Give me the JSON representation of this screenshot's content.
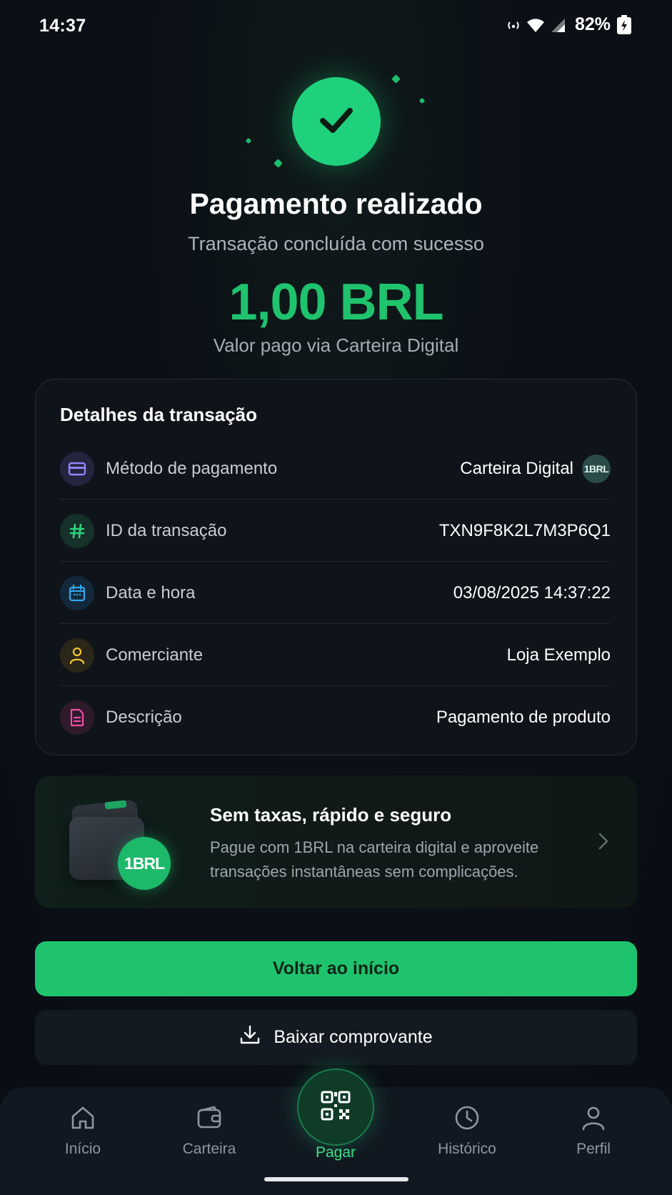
{
  "status_bar": {
    "time": "14:37",
    "battery": "82%",
    "icons": [
      "hotspot-icon",
      "wifi-icon",
      "signal-icon",
      "battery-icon"
    ]
  },
  "hero": {
    "title": "Pagamento realizado",
    "subtitle": "Transação concluída com sucesso",
    "amount": "1,00 BRL",
    "amount_caption": "Valor pago via Carteira Digital",
    "icon": "check-icon"
  },
  "details": {
    "title": "Detalhes da transação",
    "rows": [
      {
        "label": "Método de pagamento",
        "value": "Carteira Digital",
        "icon": "card-icon",
        "badge": "1BRL"
      },
      {
        "label": "ID da transação",
        "value": "TXN9F8K2L7M3P6Q1",
        "icon": "hash-icon"
      },
      {
        "label": "Data e hora",
        "value": "03/08/2025 14:37:22",
        "icon": "calendar-icon"
      },
      {
        "label": "Comerciante",
        "value": "Loja Exemplo",
        "icon": "user-icon"
      },
      {
        "label": "Descrição",
        "value": "Pagamento de produto",
        "icon": "document-icon"
      }
    ]
  },
  "promo": {
    "title": "Sem taxas, rápido e seguro",
    "text": "Pague com 1BRL na carteira digital e aproveite transações instantâneas sem complicações.",
    "coin_label": "1BRL"
  },
  "actions": {
    "primary_label": "Voltar ao início",
    "secondary_label": "Baixar comprovante"
  },
  "nav": {
    "items": [
      {
        "label": "Início",
        "icon": "home-icon"
      },
      {
        "label": "Carteira",
        "icon": "wallet-icon"
      },
      {
        "label": "Pagar",
        "icon": "qr-code-icon",
        "active": true
      },
      {
        "label": "Histórico",
        "icon": "clock-icon"
      },
      {
        "label": "Perfil",
        "icon": "profile-icon"
      }
    ]
  },
  "colors": {
    "accent": "#1fc36d",
    "background": "#0b0f16",
    "card": "#0f141b"
  }
}
